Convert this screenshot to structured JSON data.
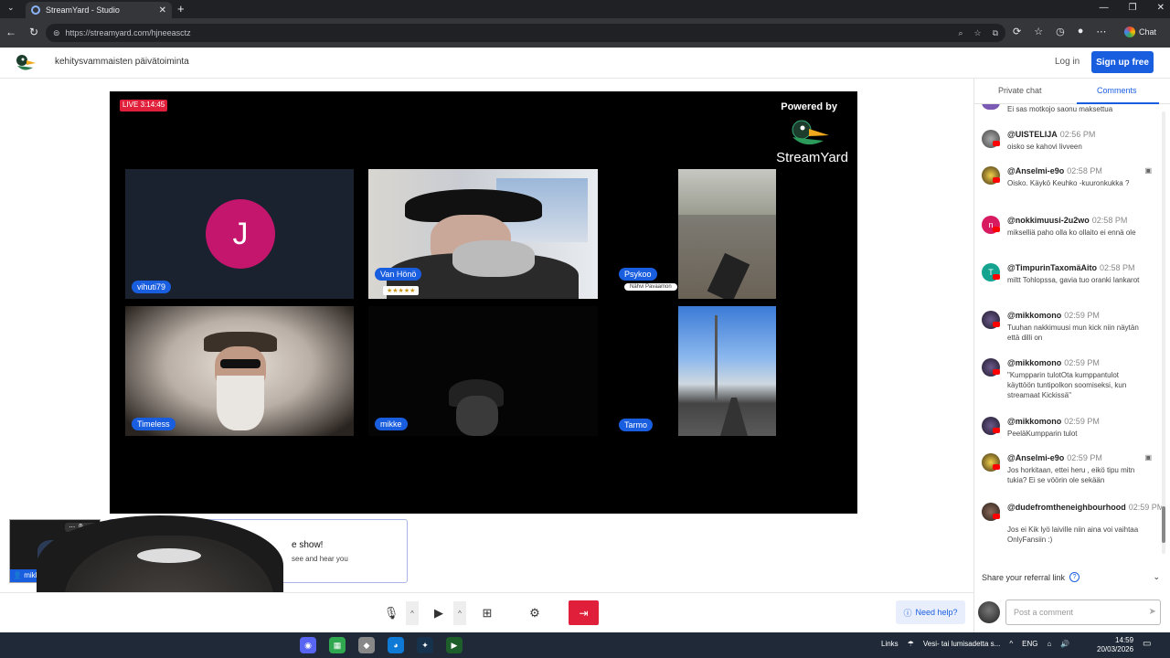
{
  "browser": {
    "tab_title": "StreamYard - Studio",
    "url": "https://streamyard.com/hjneeasctz",
    "chat_label": "Chat"
  },
  "header": {
    "title": "kehitysvammaisten päivätoiminta",
    "login": "Log in",
    "signup": "Sign up free"
  },
  "stage": {
    "live_badge": "LIVE 3:14:45",
    "powered_by": "Powered by",
    "brand": "StreamYard",
    "participants": [
      {
        "name": "vihuti79",
        "initial": "J"
      },
      {
        "name": "Van Hönö",
        "badge": "★★★★★"
      },
      {
        "name": "Psykoo",
        "badge": "Nähvi Pavaamon"
      },
      {
        "name": "Timeless"
      },
      {
        "name": "mikke"
      },
      {
        "name": "Tarmo"
      }
    ]
  },
  "self_cam": {
    "name": "mikke"
  },
  "notice": {
    "title": "e show!",
    "subtitle": "see and hear you"
  },
  "toolbar": {
    "help": "Need help?"
  },
  "panel": {
    "tabs": [
      "Private chat",
      "Comments"
    ],
    "active_tab": "Comments",
    "comments": [
      {
        "author": "",
        "time": "",
        "text": "Ei sas motkojo saonu maksettua"
      },
      {
        "author": "@UISTELIJA",
        "time": "02:56 PM",
        "text": "oisko se kahovi livveen"
      },
      {
        "author": "@Anselmi-e9o",
        "time": "02:58 PM",
        "text": "Oisko. Käykö Keuhko -kuuronkukka ?"
      },
      {
        "author": "@nokkimuusi-2u2wo",
        "time": "02:58 PM",
        "text": "mikselliä paho olla ko ollaito ei ennä ole"
      },
      {
        "author": "@TimpurinTaxomäAito",
        "time": "02:58 PM",
        "text": "miltt Tohlopssa, gavia tuo oranki lankarot"
      },
      {
        "author": "@mikkomono",
        "time": "02:59 PM",
        "text": "Tuuhan nakkimuusi mun kick niin näytän että dilli on"
      },
      {
        "author": "@mikkomono",
        "time": "02:59 PM",
        "text": "\"Kumpparin tulotOta kumppantulot käyttöön tuntipolkon soomiseksi, kun streamaat Kickissä\""
      },
      {
        "author": "@mikkomono",
        "time": "02:59 PM",
        "text": "PeeläKumpparin tulot"
      },
      {
        "author": "@Anselmi-e9o",
        "time": "02:59 PM",
        "text": "Jos horkitaan, ettei heru , eikö tipu mitn tukia? Ei se vöörin ole sekään"
      },
      {
        "author": "@dudefromtheneighbourhood",
        "time": "02:59 PM",
        "text": "Jos ei Kik lyö laiville niin aina voi vaihtaa OnlyFansiin :)"
      }
    ],
    "share_label": "Share your referral link",
    "compose_placeholder": "Post a comment"
  },
  "taskbar": {
    "links": "Links",
    "weather": "Vesi- tai lumisadetta s...",
    "lang": "ENG",
    "time": "14:59",
    "date": "20/03/2026"
  }
}
